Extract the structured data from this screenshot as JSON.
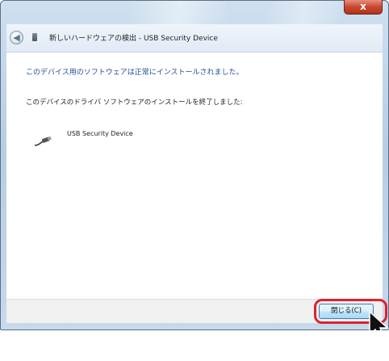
{
  "window": {
    "title": "新しいハードウェアの検出 - USB Security Device",
    "close_glyph": "x",
    "back_glyph": "◀"
  },
  "content": {
    "heading": "このデバイス用のソフトウェアは正常にインストールされました。",
    "info": "このデバイスのドライバ ソフトウェアのインストールを終了しました:",
    "device_name": "USB Security Device",
    "device_icon": "usb-cable-icon"
  },
  "footer": {
    "close_label": "閉じる(C)"
  },
  "colors": {
    "heading_blue": "#1e4a99",
    "highlight_red": "#e0202e",
    "close_button_red": "#c9482f"
  }
}
